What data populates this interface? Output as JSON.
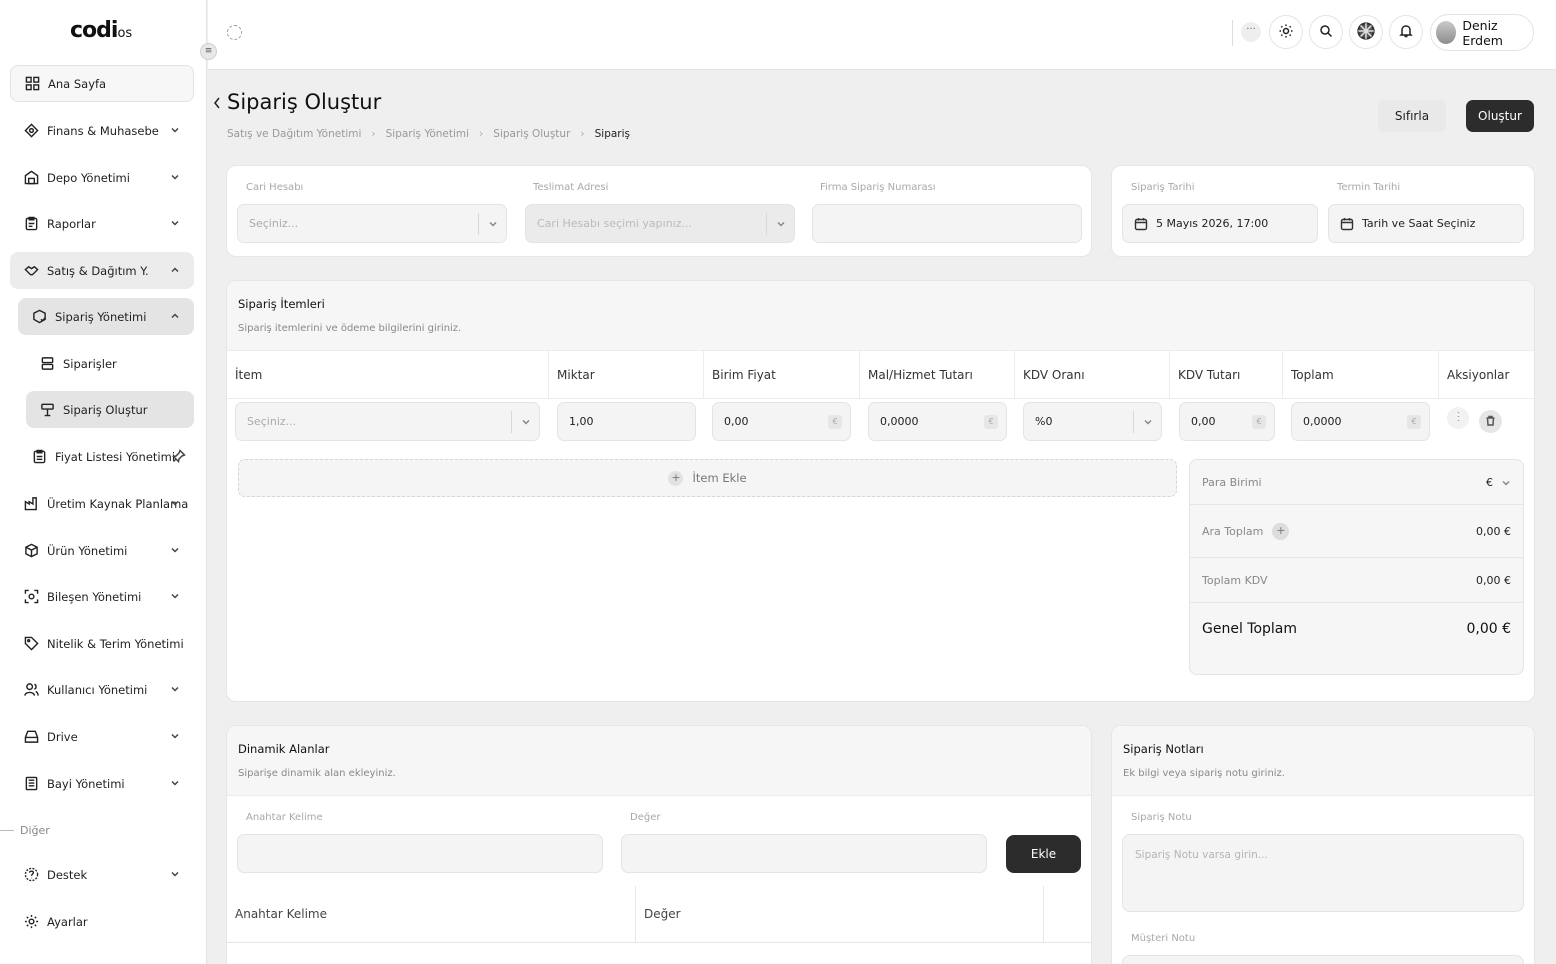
{
  "app": {
    "logo_main": "codi",
    "logo_suffix": "os"
  },
  "sidebar": {
    "items": [
      {
        "label": "Ana Sayfa"
      },
      {
        "label": "Finans & Muhasebe"
      },
      {
        "label": "Depo Yönetimi"
      },
      {
        "label": "Raporlar"
      },
      {
        "label": "Satış & Dağıtım Y."
      },
      {
        "label": "Sipariş Yönetimi"
      },
      {
        "label": "Siparişler"
      },
      {
        "label": "Sipariş Oluştur"
      },
      {
        "label": "Fiyat Listesi Yönetimi"
      },
      {
        "label": "Üretim Kaynak Planlama"
      },
      {
        "label": "Ürün Yönetimi"
      },
      {
        "label": "Bileşen Yönetimi"
      },
      {
        "label": "Nitelik & Terim Yönetimi"
      },
      {
        "label": "Kullanıcı Yönetimi"
      },
      {
        "label": "Drive"
      },
      {
        "label": "Bayi Yönetimi"
      }
    ],
    "section_other": "Diğer",
    "other_items": [
      {
        "label": "Destek"
      },
      {
        "label": "Ayarlar"
      }
    ]
  },
  "topbar": {
    "more": "···",
    "user_name": "Deniz Erdem"
  },
  "page": {
    "title": "Sipariş Oluştur",
    "breadcrumb": [
      "Satış ve Dağıtım Yönetimi",
      "Sipariş Yönetimi",
      "Sipariş Oluştur",
      "Sipariş"
    ],
    "reset_label": "Sıfırla",
    "create_label": "Oluştur"
  },
  "order_form": {
    "account_label": "Cari Hesabı",
    "account_placeholder": "Seçiniz...",
    "address_label": "Teslimat Adresi",
    "address_placeholder": "Cari Hesabı seçimi yapınız...",
    "company_no_label": "Firma Sipariş Numarası",
    "company_no_value": ""
  },
  "dates": {
    "order_date_label": "Sipariş Tarihi",
    "order_date_value": "5 Mayıs 2026, 17:00",
    "due_date_label": "Termin Tarihi",
    "due_date_value": "Tarih ve Saat Seçiniz"
  },
  "items_card": {
    "title": "Sipariş İtemleri",
    "subtitle": "Sipariş itemlerini ve ödeme bilgilerini giriniz.",
    "columns": [
      "İtem",
      "Miktar",
      "Birim Fiyat",
      "Mal/Hizmet Tutarı",
      "KDV Oranı",
      "KDV Tutarı",
      "Toplam",
      "Aksiyonlar"
    ],
    "row": {
      "item_placeholder": "Seçiniz...",
      "quantity": "1,00",
      "unit_price": "0,00",
      "goods_amount": "0,0000",
      "vat_rate": "%0",
      "vat_amount": "0,00",
      "total": "0,0000",
      "currency_symbol": "€"
    },
    "add_item_label": "İtem Ekle",
    "summary": {
      "currency_label": "Para Birimi",
      "currency_value": "€",
      "subtotal_label": "Ara Toplam",
      "subtotal_value": "0,00 €",
      "vat_total_label": "Toplam KDV",
      "vat_total_value": "0,00 €",
      "grand_total_label": "Genel Toplam",
      "grand_total_value": "0,00 €"
    }
  },
  "dynamic_card": {
    "title": "Dinamik Alanlar",
    "subtitle": "Siparişe dinamik alan ekleyiniz.",
    "key_label": "Anahtar Kelime",
    "value_label": "Değer",
    "add_label": "Ekle",
    "table_columns": [
      "Anahtar Kelime",
      "Değer"
    ]
  },
  "notes_card": {
    "title": "Sipariş Notları",
    "subtitle": "Ek bilgi veya sipariş notu giriniz.",
    "order_note_label": "Sipariş Notu",
    "order_note_placeholder": "Sipariş Notu varsa girin...",
    "customer_note_label": "Müşteri Notu"
  }
}
